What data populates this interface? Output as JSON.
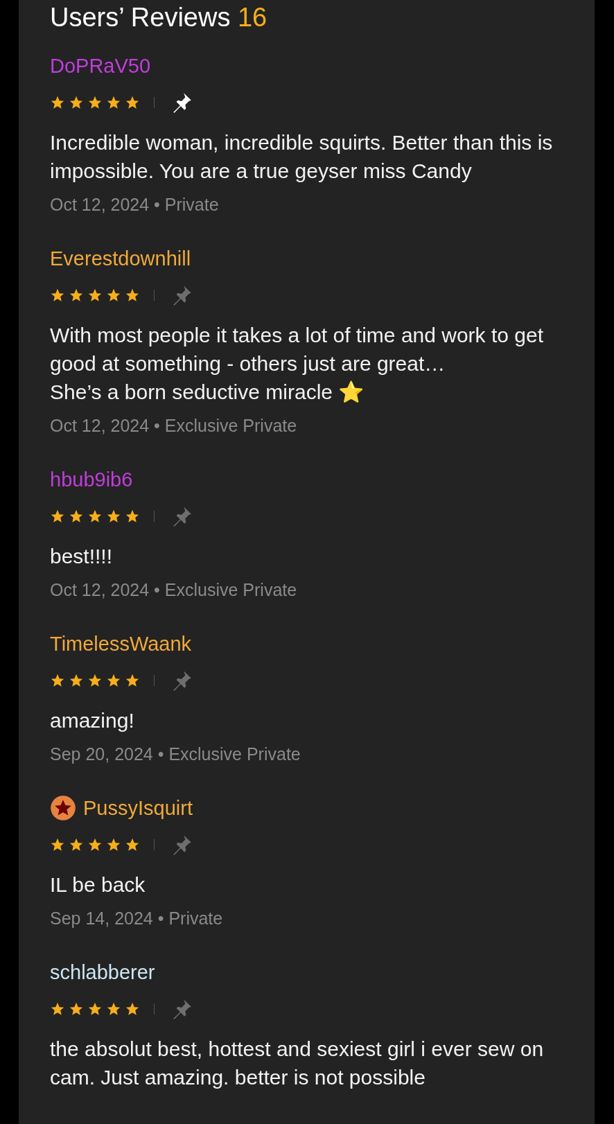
{
  "header": {
    "title": "Users’ Reviews",
    "count": "16"
  },
  "reviews": [
    {
      "user": "DoPRaV50",
      "color": "#c03ddc",
      "badge": false,
      "stars": 5,
      "pinned": true,
      "text": "Incredible woman, incredible squirts. Better than this is impossible. You are a true geyser miss Candy",
      "meta": "Oct 12, 2024 • Private"
    },
    {
      "user": "Everestdownhill",
      "color": "#f0a93a",
      "badge": false,
      "stars": 5,
      "pinned": false,
      "text": "With most people it takes a lot of time and work to get good at something - others just are great…\nShe’s a born seductive miracle ⭐",
      "meta": "Oct 12, 2024 • Exclusive Private"
    },
    {
      "user": "hbub9ib6",
      "color": "#c03ddc",
      "badge": false,
      "stars": 5,
      "pinned": false,
      "text": "best!!!!",
      "meta": "Oct 12, 2024 • Exclusive Private"
    },
    {
      "user": "TimelessWaank",
      "color": "#f0a93a",
      "badge": false,
      "stars": 5,
      "pinned": false,
      "text": "amazing!",
      "meta": "Sep 20, 2024 • Exclusive Private"
    },
    {
      "user": "PussyIsquirt",
      "color": "#f0a93a",
      "badge": true,
      "stars": 5,
      "pinned": false,
      "text": "IL be back",
      "meta": "Sep 14, 2024 • Private"
    },
    {
      "user": "schlabberer",
      "color": "#cde6f3",
      "badge": false,
      "stars": 5,
      "pinned": false,
      "text": "the absolut best, hottest and sexiest girl i ever sew on cam. Just amazing. better is not possible"
    }
  ]
}
